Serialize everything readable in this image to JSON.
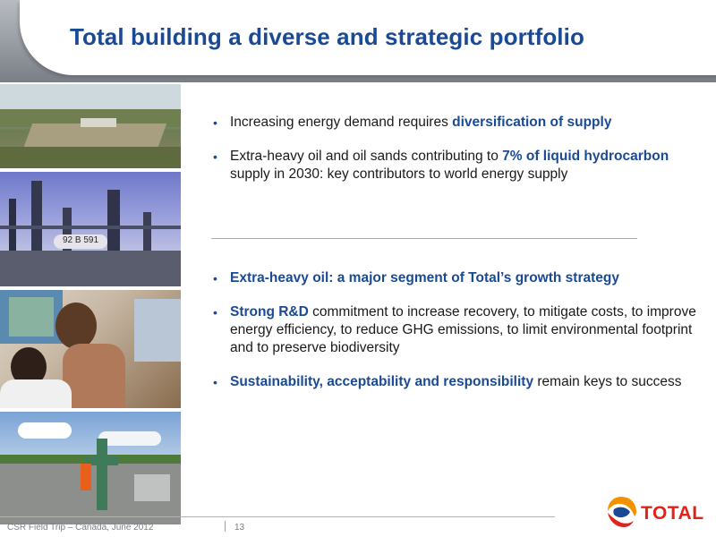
{
  "title": "Total building a diverse and strategic portfolio",
  "section1": {
    "bullets": [
      {
        "parts": [
          {
            "text": "Increasing energy demand requires ",
            "bold": false
          },
          {
            "text": "diversification of supply",
            "bold": true
          }
        ]
      },
      {
        "parts": [
          {
            "text": "Extra-heavy oil and oil sands contributing to ",
            "bold": false
          },
          {
            "text": "7% of liquid hydrocarbon",
            "bold": true
          },
          {
            "text": " supply in 2030: key contributors to world energy supply",
            "bold": false
          }
        ]
      }
    ]
  },
  "section2": {
    "bullets": [
      {
        "parts": [
          {
            "text": "Extra-heavy oil: a major segment of Total’s growth strategy",
            "bold": true
          }
        ]
      },
      {
        "parts": [
          {
            "text": "Strong R&D",
            "bold": true
          },
          {
            "text": " commitment to increase recovery, to mitigate costs, to improve energy efficiency, to reduce GHG emissions, to limit environmental footprint and to preserve biodiversity",
            "bold": false
          }
        ]
      },
      {
        "parts": [
          {
            "text": "Sustainability, acceptability and responsibility",
            "bold": true
          },
          {
            "text": " remain keys to success",
            "bold": false
          }
        ]
      }
    ]
  },
  "photos": {
    "refinery_label": "92 B 591"
  },
  "footer": {
    "text": "CSR Field Trip – Canada, June 2012",
    "page": "13"
  },
  "logo": {
    "text": "TOTAL"
  },
  "colors": {
    "brand_blue": "#1b4a94",
    "brand_red": "#e2231a",
    "brand_orange": "#f39200"
  }
}
